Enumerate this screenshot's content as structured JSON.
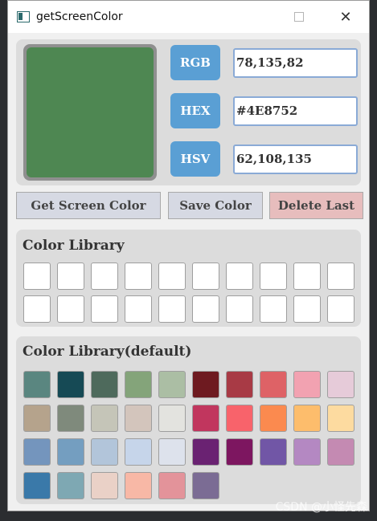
{
  "window": {
    "title": "getScreenColor",
    "max_glyph": "☐",
    "close_glyph": "✕"
  },
  "current_color": "#4E8752",
  "values": [
    {
      "label": "RGB",
      "value": "78,135,82"
    },
    {
      "label": "HEX",
      "value": "#4E8752"
    },
    {
      "label": "HSV",
      "value": "62,108,135"
    }
  ],
  "buttons": {
    "get_screen": {
      "label": "Get Screen Color",
      "bg": "#d6d9e3"
    },
    "save": {
      "label": "Save Color",
      "bg": "#d6d9e3"
    },
    "delete": {
      "label": "Delete Last",
      "bg": "#e7bdbd"
    }
  },
  "library": {
    "title": "Color Library",
    "rows": 2,
    "cols": 10
  },
  "default_library": {
    "title": "Color Library(default)",
    "colors": [
      "#5a8680",
      "#164a55",
      "#4e6a5c",
      "#84a47a",
      "#abbea4",
      "#6e1a20",
      "#a83a45",
      "#de6266",
      "#f2a2b1",
      "#e6cbd9",
      "#b5a38c",
      "#7f8a7c",
      "#c5c5b8",
      "#d3c5bc",
      "#e3e3df",
      "#c1365e",
      "#f8636b",
      "#fb8a4f",
      "#fdbd6c",
      "#fddba0",
      "#7495bd",
      "#749ec0",
      "#b2c5da",
      "#c6d5ea",
      "#dde2ec",
      "#6a2272",
      "#7d1660",
      "#7156a6",
      "#b488c2",
      "#c48ab2",
      "#3a79a9",
      "#7ea8b3",
      "#ead1c7",
      "#f8b8a6",
      "#e3939a",
      "#7b6c94"
    ]
  },
  "watermark": "CSDN @小怪先森"
}
